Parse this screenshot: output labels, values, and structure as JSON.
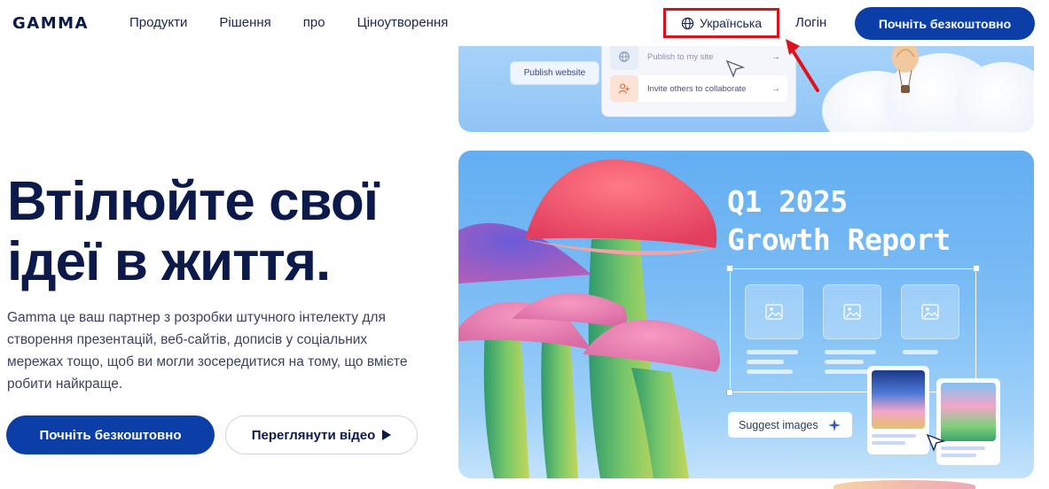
{
  "header": {
    "logo": "GAMMA",
    "nav": [
      "Продукти",
      "Рішення",
      "про",
      "Ціноутворення"
    ],
    "language": "Українська",
    "login": "Логін",
    "cta": "Почніть безкоштовно"
  },
  "hero": {
    "title_line1": "Втілюйте свої",
    "title_line2": "ідеї в життя.",
    "description": "Gamma це ваш партнер з розробки штучного інтелекту для створення презентацій, веб-сайтів, дописів у соціальних мережах тощо, щоб ви могли зосередитися на тому, що вмієте робити найкраще.",
    "primary_button": "Почніть безкоштовно",
    "secondary_button": "Переглянути відео"
  },
  "top_card": {
    "publish_button": "Publish website",
    "menu_items": [
      "Publish to my site",
      "Invite others to collaborate"
    ]
  },
  "main_card": {
    "report_title_line1": "Q1 2025",
    "report_title_line2": "Growth Report",
    "suggest_button": "Suggest images"
  },
  "colors": {
    "brand": "#0b3ea7",
    "heading": "#0b1a4a",
    "highlight": "#e0101a"
  }
}
